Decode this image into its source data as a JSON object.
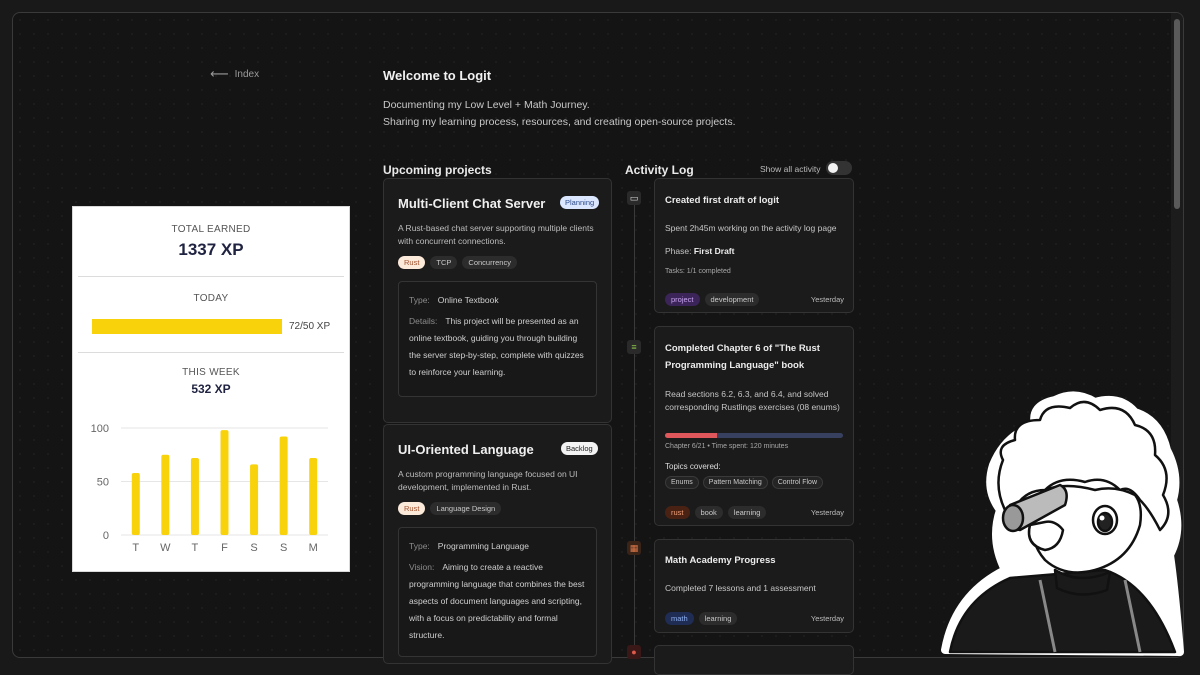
{
  "nav": {
    "back_label": "Index"
  },
  "intro": {
    "title": "Welcome to Logit",
    "line1": "Documenting my Low Level + Math Journey.",
    "line2": "Sharing my learning process, resources, and creating open-source projects."
  },
  "projects": {
    "section_title": "Upcoming projects",
    "items": [
      {
        "title": "Multi-Client Chat Server",
        "status": "Planning",
        "description": "A Rust-based chat server supporting multiple clients with concurrent connections.",
        "tags": [
          "Rust",
          "TCP",
          "Concurrency"
        ],
        "type_key": "Type:",
        "type_val": "Online Textbook",
        "detail_key": "Details:",
        "detail_val": "This project will be presented as an online textbook, guiding you through building the server step-by-step, complete with quizzes to reinforce your learning."
      },
      {
        "title": "UI-Oriented Language",
        "status": "Backlog",
        "description": "A custom programming language focused on UI development, implemented in Rust.",
        "tags": [
          "Rust",
          "Language Design"
        ],
        "type_key": "Type:",
        "type_val": "Programming Language",
        "detail_key": "Vision:",
        "detail_val": "Aiming to create a reactive programming language that combines the best aspects of document languages and scripting, with a focus on predictability and formal structure."
      }
    ]
  },
  "activity": {
    "section_title": "Activity Log",
    "toggle_label": "Show all activity",
    "toggle_on": false,
    "entries": [
      {
        "title": "Created first draft of logit",
        "text": "Spent 2h45m working on the activity log page",
        "phase_key": "Phase:",
        "phase_val": "First Draft",
        "tasks": "Tasks: 1/1 completed",
        "tags": [
          "project",
          "development"
        ],
        "time": "Yesterday",
        "icon": "laptop-icon"
      },
      {
        "title": "Completed Chapter 6 of \"The Rust Programming Language\" book",
        "text": "Read sections 6.2, 6.3, and 6.4, and solved corresponding Rustlings exercises (08 enums)",
        "progress": 0.29,
        "progress_text": "Chapter 6/21 • Time spent: 120 minutes",
        "topics_label": "Topics covered:",
        "topics": [
          "Enums",
          "Pattern Matching",
          "Control Flow"
        ],
        "tags": [
          "rust",
          "book",
          "learning"
        ],
        "time": "Yesterday",
        "icon": "books-icon"
      },
      {
        "title": "Math Academy Progress",
        "text": "Completed 7 lessons and 1 assessment",
        "tags": [
          "math",
          "learning"
        ],
        "time": "Yesterday",
        "icon": "calendar-icon"
      }
    ]
  },
  "xp": {
    "total_label": "TOTAL EARNED",
    "total_value": "1337 XP",
    "today_label": "TODAY",
    "today_value": "72/50 XP",
    "week_label": "THIS WEEK",
    "week_value": "532 XP"
  },
  "chart_data": {
    "type": "bar",
    "categories": [
      "T",
      "W",
      "T",
      "F",
      "S",
      "S",
      "M"
    ],
    "values": [
      58,
      75,
      72,
      98,
      66,
      92,
      72
    ],
    "ylim": [
      0,
      100
    ],
    "yticks": [
      0,
      50,
      100
    ],
    "color": "#f8d20a",
    "grid": true
  }
}
